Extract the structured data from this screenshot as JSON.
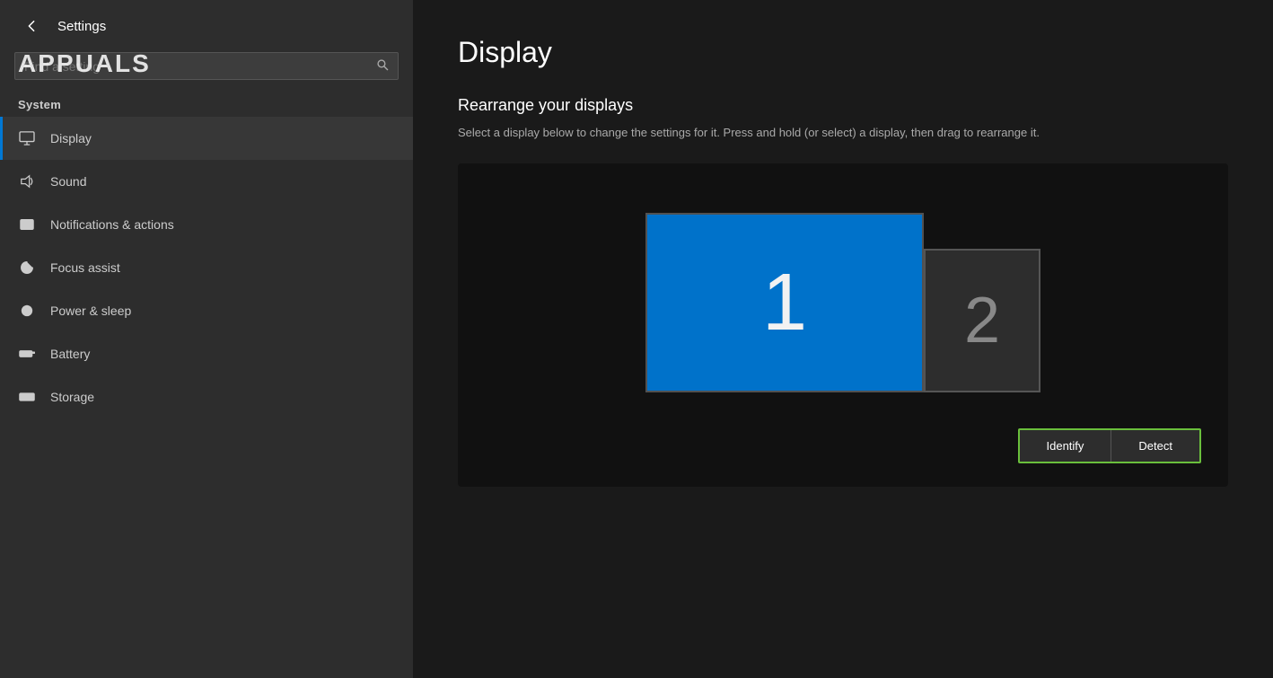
{
  "app": {
    "title": "Settings",
    "back_label": "←"
  },
  "logo": {
    "text": "APPUALS"
  },
  "search": {
    "placeholder": "Find a setting"
  },
  "sidebar": {
    "system_label": "System",
    "items": [
      {
        "id": "display",
        "label": "Display",
        "icon": "display-icon",
        "active": true
      },
      {
        "id": "sound",
        "label": "Sound",
        "icon": "sound-icon",
        "active": false
      },
      {
        "id": "notifications",
        "label": "Notifications & actions",
        "icon": "notifications-icon",
        "active": false
      },
      {
        "id": "focus",
        "label": "Focus assist",
        "icon": "focus-icon",
        "active": false
      },
      {
        "id": "power",
        "label": "Power & sleep",
        "icon": "power-icon",
        "active": false
      },
      {
        "id": "battery",
        "label": "Battery",
        "icon": "battery-icon",
        "active": false
      },
      {
        "id": "storage",
        "label": "Storage",
        "icon": "storage-icon",
        "active": false
      }
    ]
  },
  "main": {
    "page_title": "Display",
    "section_title": "Rearrange your displays",
    "section_desc": "Select a display below to change the settings for it. Press and hold (or select) a display, then drag to rearrange it.",
    "monitor1_number": "1",
    "monitor2_number": "2",
    "identify_label": "Identify",
    "detect_label": "Detect"
  }
}
